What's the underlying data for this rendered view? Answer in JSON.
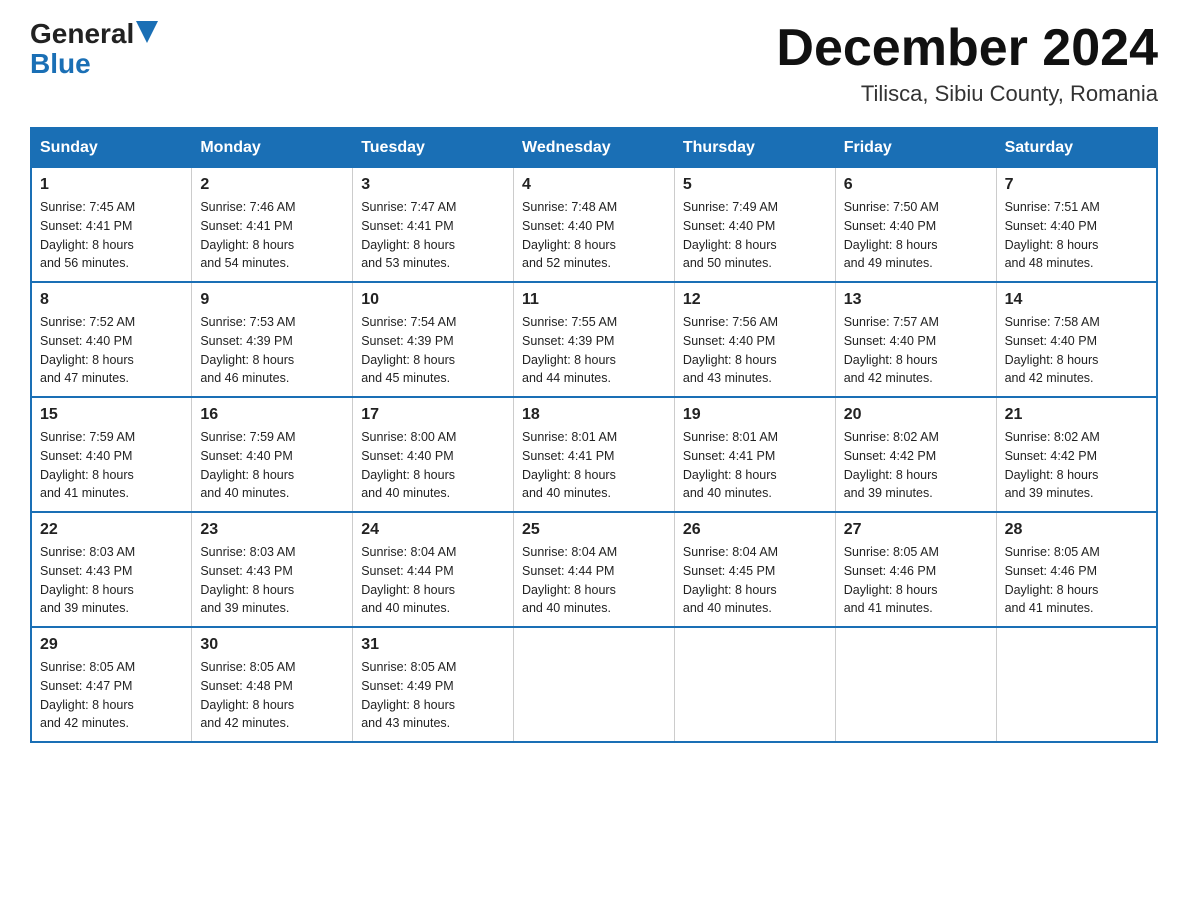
{
  "header": {
    "logo_general": "General",
    "logo_blue": "Blue",
    "month_title": "December 2024",
    "location": "Tilisca, Sibiu County, Romania"
  },
  "days_of_week": [
    "Sunday",
    "Monday",
    "Tuesday",
    "Wednesday",
    "Thursday",
    "Friday",
    "Saturday"
  ],
  "weeks": [
    [
      {
        "day": "1",
        "sunrise": "7:45 AM",
        "sunset": "4:41 PM",
        "daylight": "8 hours and 56 minutes."
      },
      {
        "day": "2",
        "sunrise": "7:46 AM",
        "sunset": "4:41 PM",
        "daylight": "8 hours and 54 minutes."
      },
      {
        "day": "3",
        "sunrise": "7:47 AM",
        "sunset": "4:41 PM",
        "daylight": "8 hours and 53 minutes."
      },
      {
        "day": "4",
        "sunrise": "7:48 AM",
        "sunset": "4:40 PM",
        "daylight": "8 hours and 52 minutes."
      },
      {
        "day": "5",
        "sunrise": "7:49 AM",
        "sunset": "4:40 PM",
        "daylight": "8 hours and 50 minutes."
      },
      {
        "day": "6",
        "sunrise": "7:50 AM",
        "sunset": "4:40 PM",
        "daylight": "8 hours and 49 minutes."
      },
      {
        "day": "7",
        "sunrise": "7:51 AM",
        "sunset": "4:40 PM",
        "daylight": "8 hours and 48 minutes."
      }
    ],
    [
      {
        "day": "8",
        "sunrise": "7:52 AM",
        "sunset": "4:40 PM",
        "daylight": "8 hours and 47 minutes."
      },
      {
        "day": "9",
        "sunrise": "7:53 AM",
        "sunset": "4:39 PM",
        "daylight": "8 hours and 46 minutes."
      },
      {
        "day": "10",
        "sunrise": "7:54 AM",
        "sunset": "4:39 PM",
        "daylight": "8 hours and 45 minutes."
      },
      {
        "day": "11",
        "sunrise": "7:55 AM",
        "sunset": "4:39 PM",
        "daylight": "8 hours and 44 minutes."
      },
      {
        "day": "12",
        "sunrise": "7:56 AM",
        "sunset": "4:40 PM",
        "daylight": "8 hours and 43 minutes."
      },
      {
        "day": "13",
        "sunrise": "7:57 AM",
        "sunset": "4:40 PM",
        "daylight": "8 hours and 42 minutes."
      },
      {
        "day": "14",
        "sunrise": "7:58 AM",
        "sunset": "4:40 PM",
        "daylight": "8 hours and 42 minutes."
      }
    ],
    [
      {
        "day": "15",
        "sunrise": "7:59 AM",
        "sunset": "4:40 PM",
        "daylight": "8 hours and 41 minutes."
      },
      {
        "day": "16",
        "sunrise": "7:59 AM",
        "sunset": "4:40 PM",
        "daylight": "8 hours and 40 minutes."
      },
      {
        "day": "17",
        "sunrise": "8:00 AM",
        "sunset": "4:40 PM",
        "daylight": "8 hours and 40 minutes."
      },
      {
        "day": "18",
        "sunrise": "8:01 AM",
        "sunset": "4:41 PM",
        "daylight": "8 hours and 40 minutes."
      },
      {
        "day": "19",
        "sunrise": "8:01 AM",
        "sunset": "4:41 PM",
        "daylight": "8 hours and 40 minutes."
      },
      {
        "day": "20",
        "sunrise": "8:02 AM",
        "sunset": "4:42 PM",
        "daylight": "8 hours and 39 minutes."
      },
      {
        "day": "21",
        "sunrise": "8:02 AM",
        "sunset": "4:42 PM",
        "daylight": "8 hours and 39 minutes."
      }
    ],
    [
      {
        "day": "22",
        "sunrise": "8:03 AM",
        "sunset": "4:43 PM",
        "daylight": "8 hours and 39 minutes."
      },
      {
        "day": "23",
        "sunrise": "8:03 AM",
        "sunset": "4:43 PM",
        "daylight": "8 hours and 39 minutes."
      },
      {
        "day": "24",
        "sunrise": "8:04 AM",
        "sunset": "4:44 PM",
        "daylight": "8 hours and 40 minutes."
      },
      {
        "day": "25",
        "sunrise": "8:04 AM",
        "sunset": "4:44 PM",
        "daylight": "8 hours and 40 minutes."
      },
      {
        "day": "26",
        "sunrise": "8:04 AM",
        "sunset": "4:45 PM",
        "daylight": "8 hours and 40 minutes."
      },
      {
        "day": "27",
        "sunrise": "8:05 AM",
        "sunset": "4:46 PM",
        "daylight": "8 hours and 41 minutes."
      },
      {
        "day": "28",
        "sunrise": "8:05 AM",
        "sunset": "4:46 PM",
        "daylight": "8 hours and 41 minutes."
      }
    ],
    [
      {
        "day": "29",
        "sunrise": "8:05 AM",
        "sunset": "4:47 PM",
        "daylight": "8 hours and 42 minutes."
      },
      {
        "day": "30",
        "sunrise": "8:05 AM",
        "sunset": "4:48 PM",
        "daylight": "8 hours and 42 minutes."
      },
      {
        "day": "31",
        "sunrise": "8:05 AM",
        "sunset": "4:49 PM",
        "daylight": "8 hours and 43 minutes."
      },
      null,
      null,
      null,
      null
    ]
  ],
  "labels": {
    "sunrise": "Sunrise:",
    "sunset": "Sunset:",
    "daylight": "Daylight:"
  }
}
